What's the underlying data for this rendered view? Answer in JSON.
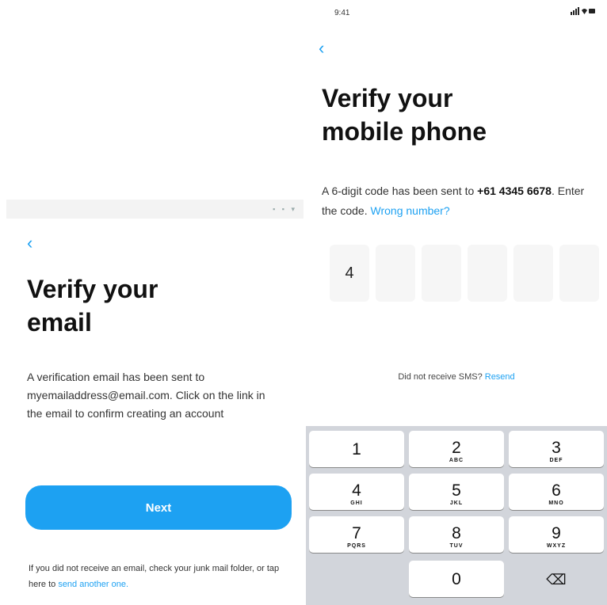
{
  "left": {
    "back_glyph": "‹",
    "title_line1": "Verify your",
    "title_line2": "email",
    "body": "A verification email has been sent to myemailaddress@email.com. Click on the link in the email to confirm creating an account",
    "next_label": "Next",
    "hint_text": "If you did not receive an email, check your junk mail folder, or tap here to ",
    "hint_link": "send another one."
  },
  "right": {
    "time": "9:41",
    "back_glyph": "‹",
    "title_line1": "Verify your",
    "title_line2": "mobile phone",
    "body_prefix": "A 6-digit code has been sent to ",
    "phone": "+61 4345 6678",
    "body_middle": ". Enter the code. ",
    "wrong_number": "Wrong number?",
    "code_digits": [
      "4",
      "",
      "",
      "",
      "",
      ""
    ],
    "resend_text": "Did not receive SMS? ",
    "resend_link": "Resend"
  },
  "keypad": {
    "keys": [
      {
        "num": "1",
        "letters": ""
      },
      {
        "num": "2",
        "letters": "ABC"
      },
      {
        "num": "3",
        "letters": "DEF"
      },
      {
        "num": "4",
        "letters": "GHI"
      },
      {
        "num": "5",
        "letters": "JKL"
      },
      {
        "num": "6",
        "letters": "MNO"
      },
      {
        "num": "7",
        "letters": "PQRS"
      },
      {
        "num": "8",
        "letters": "TUV"
      },
      {
        "num": "9",
        "letters": "WXYZ"
      },
      {
        "num": "0",
        "letters": ""
      }
    ],
    "delete_glyph": "⌫"
  }
}
